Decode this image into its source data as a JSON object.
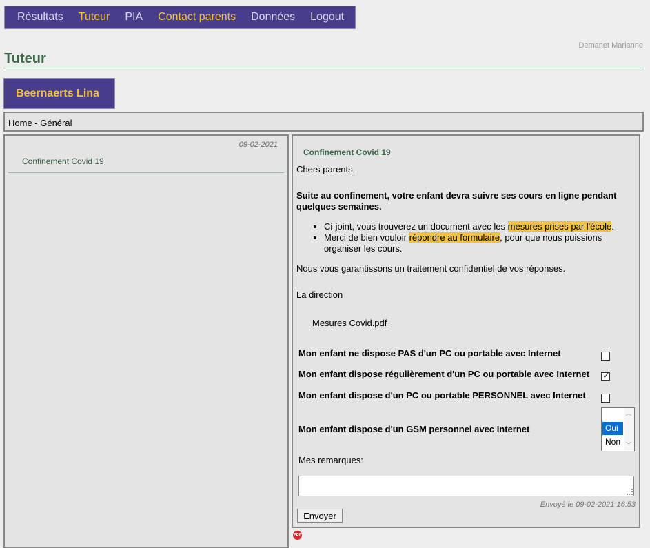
{
  "nav": {
    "items": [
      {
        "label": "Résultats",
        "color": "#d8d6ee"
      },
      {
        "label": "Tuteur",
        "color": "#f2c23c"
      },
      {
        "label": "PIA",
        "color": "#d8d6ee"
      },
      {
        "label": "Contact parents",
        "color": "#f2c23c"
      },
      {
        "label": "Données",
        "color": "#d8d6ee"
      },
      {
        "label": "Logout",
        "color": "#d8d6ee"
      }
    ]
  },
  "user": {
    "name": "Demanet Marianne"
  },
  "page": {
    "title": "Tuteur"
  },
  "student": {
    "name": "Beernaerts Lina"
  },
  "breadcrumb": "Home - Général",
  "message_list": [
    {
      "date": "09-02-2021",
      "subject": "Confinement Covid 19"
    }
  ],
  "message": {
    "subject": "Confinement Covid 19",
    "greeting": "Chers parents,",
    "intro": "Suite au confinement, votre enfant devra suivre ses cours en ligne pendant quelques semaines.",
    "bullets": [
      {
        "before": "Ci-joint, vous trouverez un document avec les ",
        "highlight": "mesures prises par l'école",
        "after": "."
      },
      {
        "before": "Merci de bien vouloir ",
        "highlight": "répondre au formulaire",
        "after": ", pour que nous puissions organiser les cours."
      }
    ],
    "confidentiality": "Nous vous garantissons un traitement confidentiel de vos réponses.",
    "signature": "La direction",
    "attachment": "Mesures Covid.pdf"
  },
  "form": {
    "questions": [
      {
        "label": "Mon enfant ne dispose PAS d'un PC ou portable avec Internet",
        "checked": false
      },
      {
        "label": "Mon enfant dispose régulièrement d'un PC ou portable avec Internet",
        "checked": true
      },
      {
        "label": "Mon enfant dispose d'un PC ou portable PERSONNEL avec Internet",
        "checked": false
      }
    ],
    "gsm_question": "Mon enfant dispose d'un GSM personnel avec Internet",
    "gsm_options": [
      "",
      "Oui",
      "Non"
    ],
    "gsm_selected": "Oui",
    "remarks_label": "Mes remarques:",
    "remarks_value": "",
    "sent_info": "Envoyé le 09-02-2021 16:53",
    "submit_label": "Envoyer"
  },
  "footer_icon": {
    "name": "pdf-icon",
    "text": "PDF"
  },
  "colors": {
    "nav_bg": "#473d8b",
    "accent_gold": "#f2c23c",
    "title_green": "#3a6a46",
    "panel_bg": "#e4e4e4",
    "selected_blue": "#0a6ed1"
  }
}
